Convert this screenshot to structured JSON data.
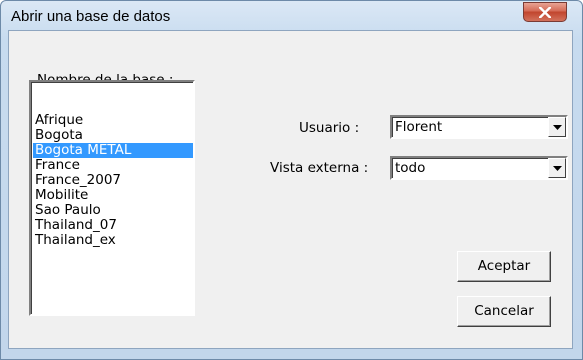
{
  "window": {
    "title": "Abrir una base de datos"
  },
  "database_list": {
    "label": "Nombre de la base :",
    "items": [
      "Afrique",
      "Bogota",
      "Bogota METAL",
      "France",
      "France_2007",
      "Mobilite",
      "Sao Paulo",
      "Thailand_07",
      "Thailand_ex"
    ],
    "selected": "Bogota METAL"
  },
  "user": {
    "label": "Usuario :",
    "value": "Florent"
  },
  "external_view": {
    "label": "Vista externa :",
    "value": "todo"
  },
  "buttons": {
    "accept": "Aceptar",
    "cancel": "Cancelar"
  },
  "colors": {
    "selection": "#3399ff",
    "close_button": "#c1452d"
  },
  "icons": {
    "close": "close-icon",
    "dropdown": "chevron-down-icon"
  }
}
